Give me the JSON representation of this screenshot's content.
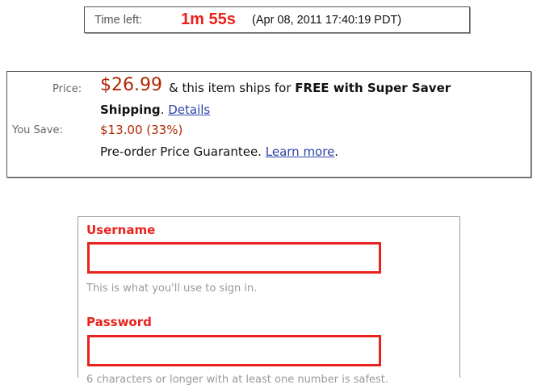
{
  "auction_timer": {
    "label": "Time left:",
    "remaining": "1m 55s",
    "end_date": "(Apr 08, 2011 17:40:19 PDT)",
    "remaining_color": "#e8221c"
  },
  "price_block": {
    "price_label": "Price:",
    "price": "$26.99",
    "ships_prefix": "& this item ships for",
    "ships_bold": "FREE with Super Saver",
    "ships_bold_2": "Shipping",
    "ships_suffix": ".",
    "details_link": "Details",
    "save_label": "You Save:",
    "save_amount": "$13.00 (33%)",
    "guarantee_text": "Pre-order Price Guarantee.",
    "learn_more_link": "Learn more",
    "guarantee_end": ".",
    "price_color": "#b12704",
    "link_color": "#2b42a8"
  },
  "signup_form": {
    "username_label": "Username",
    "username_value": "",
    "username_hint": "This is what you'll use to sign in.",
    "password_label": "Password",
    "password_value": "",
    "password_hint": "6 characters or longer with at least one number is safest.",
    "error_color": "#e8221c"
  }
}
